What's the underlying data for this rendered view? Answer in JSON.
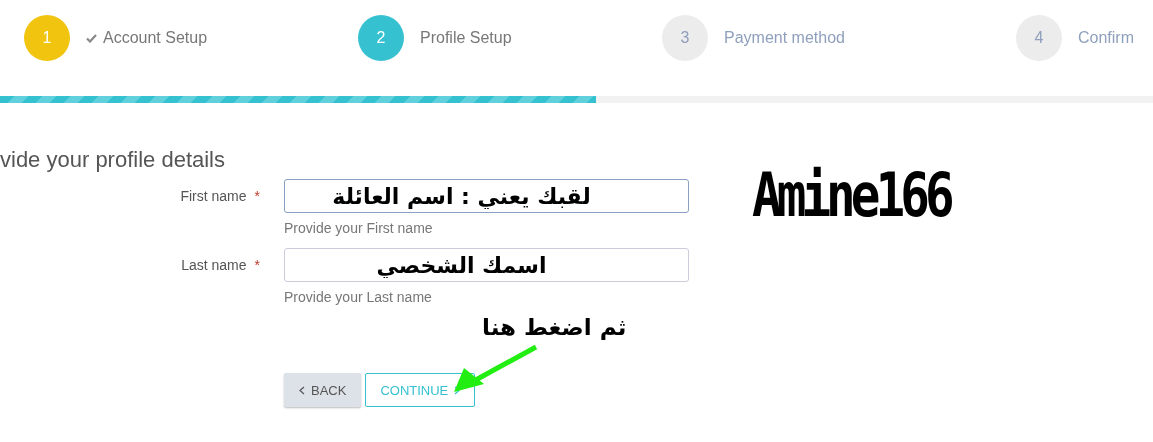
{
  "steps": [
    {
      "number": "1",
      "label": "Account Setup",
      "completed": true,
      "selected": false
    },
    {
      "number": "2",
      "label": "Profile Setup",
      "completed": false,
      "selected": true
    },
    {
      "number": "3",
      "label": "Payment method",
      "completed": false,
      "selected": false
    },
    {
      "number": "4",
      "label": "Confirm",
      "completed": false,
      "selected": false
    }
  ],
  "progress": {
    "level": 0.517
  },
  "heading": "vide your profile details",
  "fields": [
    {
      "label": "First name",
      "required_mark": "*",
      "value": "لقبك يعني : اسم العائلة",
      "help": "Provide your First name",
      "focused": true
    },
    {
      "label": "Last name",
      "required_mark": "*",
      "value": "اسمك الشخصي",
      "help": "Provide your Last name",
      "focused": false
    }
  ],
  "buttons": [
    {
      "label": "BACK",
      "kind": "back"
    },
    {
      "label": "CONTINUE",
      "kind": "continue"
    }
  ],
  "annotations": {
    "hint": "ثم اضغط هنا",
    "signature": "Amine166"
  }
}
